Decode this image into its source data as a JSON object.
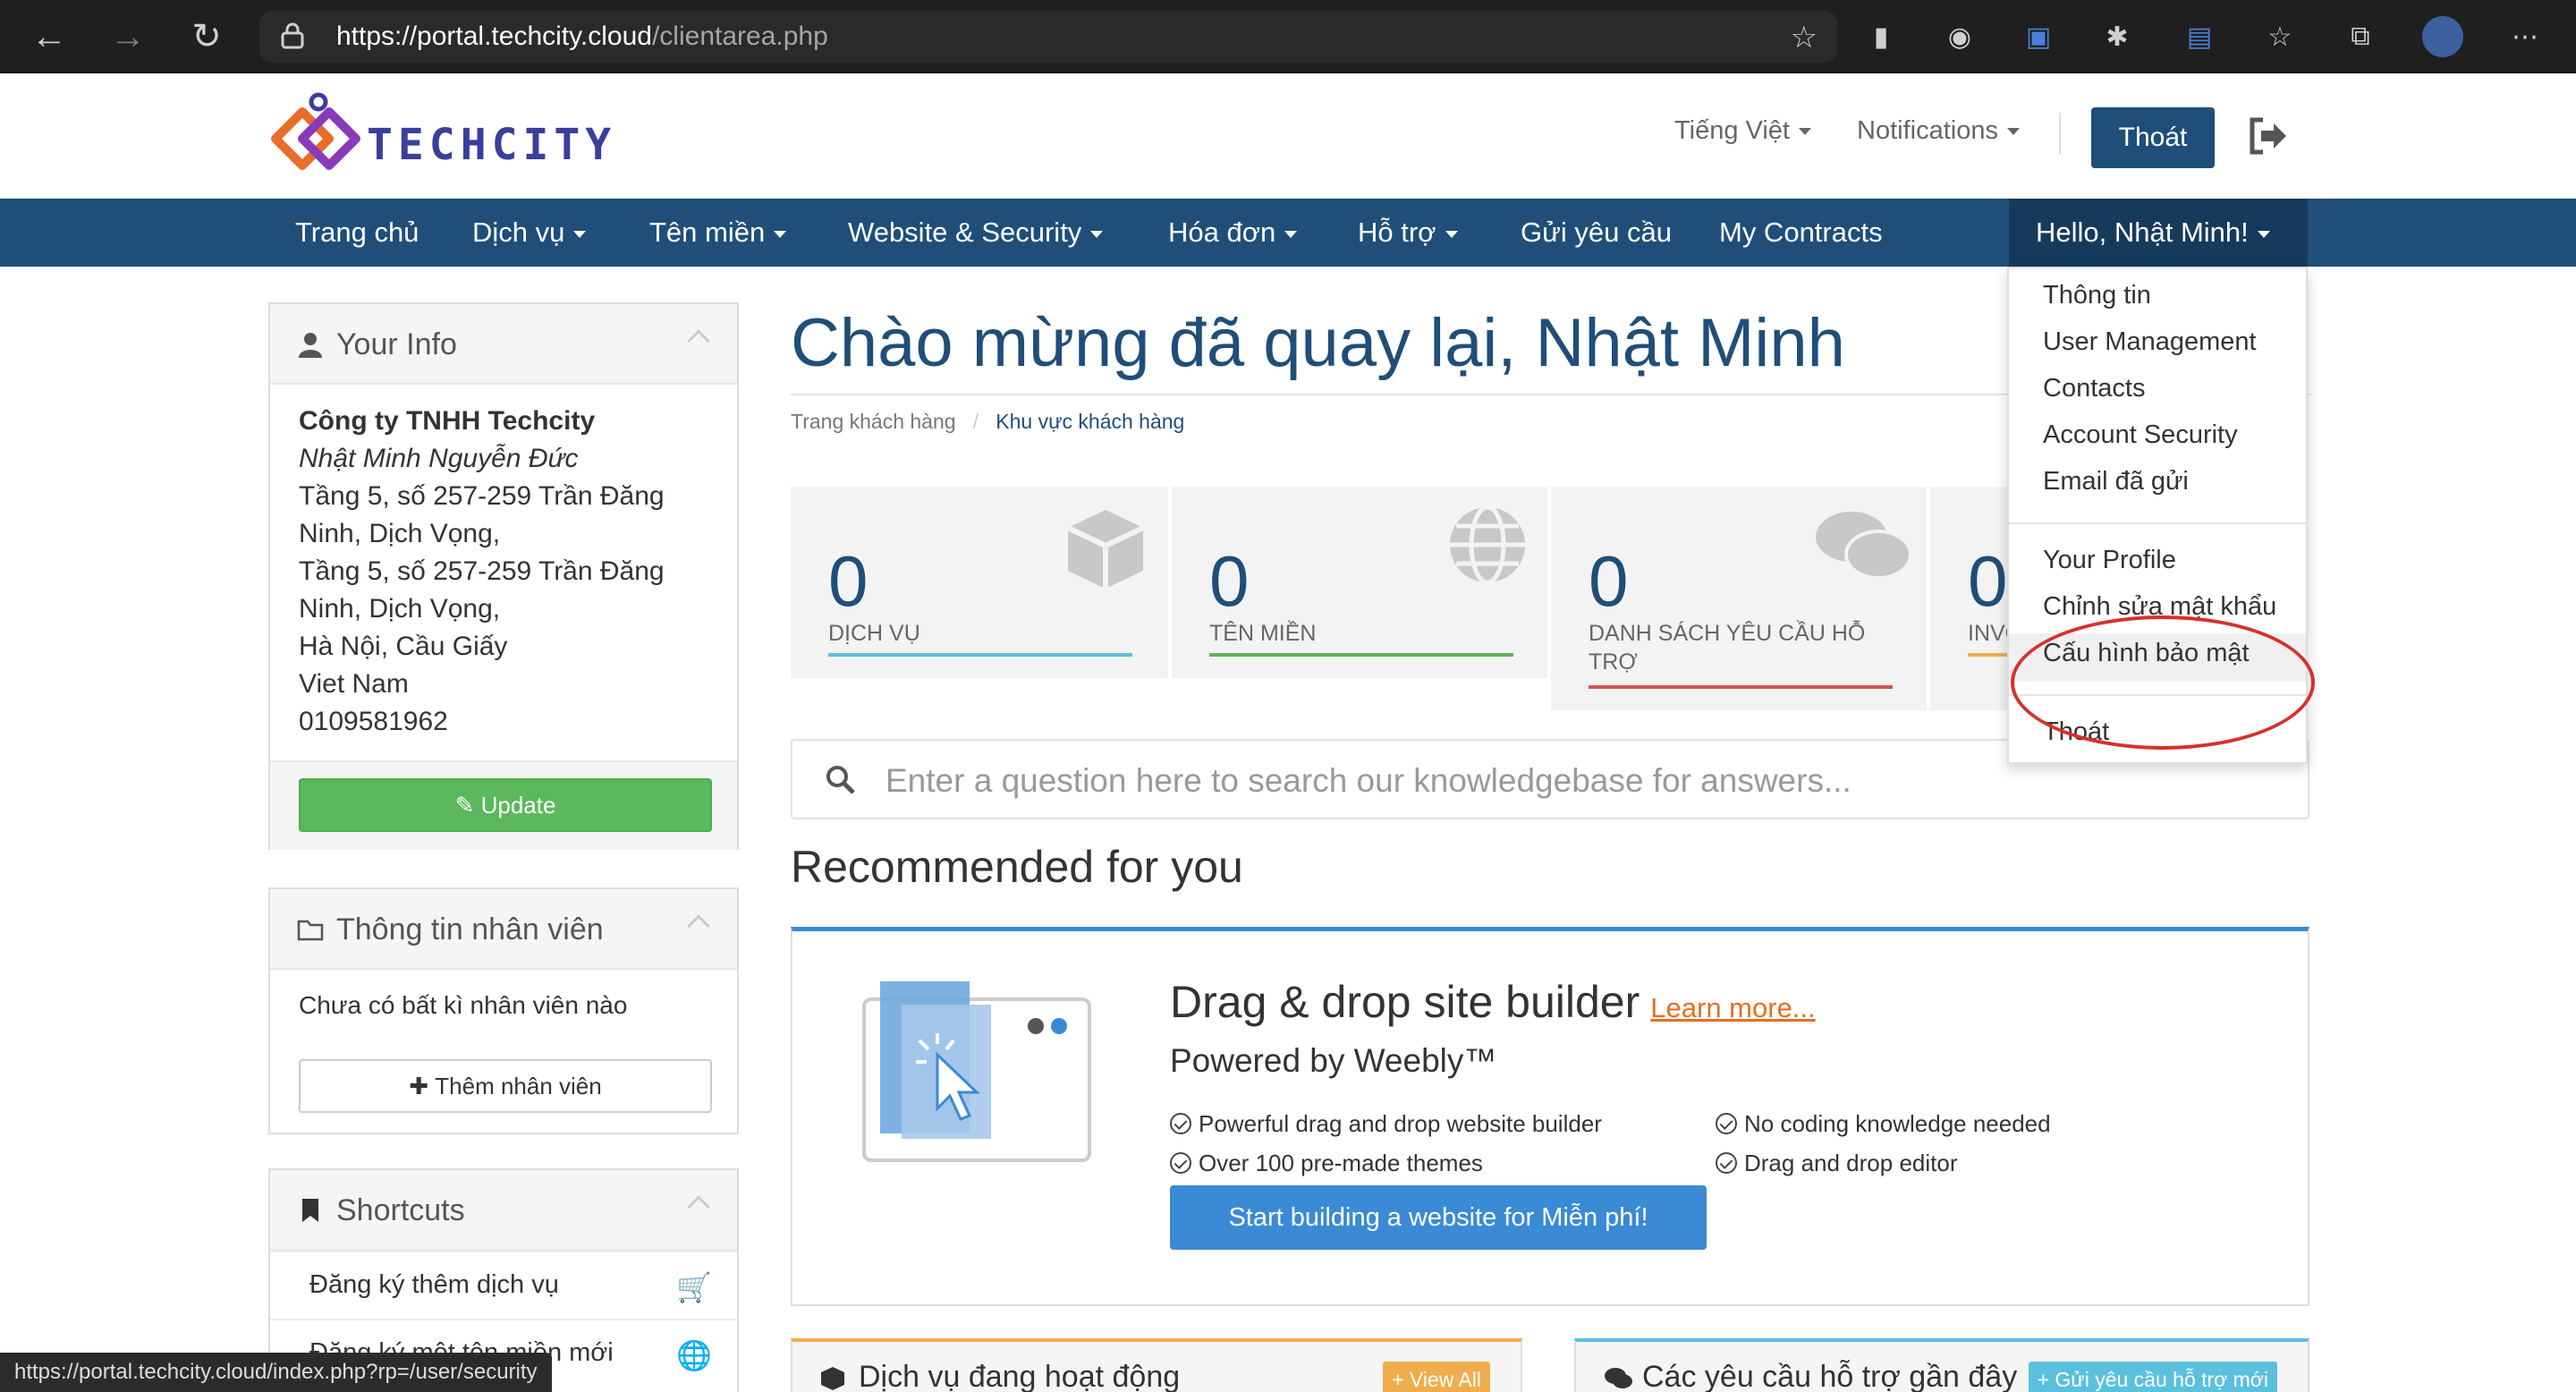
{
  "browser": {
    "url_main": "https://portal.techcity.cloud",
    "url_path": "/clientarea.php",
    "status_url": "https://portal.techcity.cloud/index.php?rp=/user/security"
  },
  "header": {
    "logo_text": "TECHCITY",
    "language": "Tiếng Việt",
    "notifications": "Notifications",
    "logout_button": "Thoát"
  },
  "nav": {
    "items": [
      "Trang chủ",
      "Dịch vụ",
      "Tên miền",
      "Website & Security",
      "Hóa đơn",
      "Hỗ trợ",
      "Gửi yêu cầu",
      "My Contracts"
    ],
    "user": "Hello, Nhật Minh!"
  },
  "dropdown": {
    "items": [
      "Thông tin",
      "User Management",
      "Contacts",
      "Account Security",
      "Email đã gửi",
      "Your Profile",
      "Chỉnh sửa mật khẩu",
      "Cấu hình bảo mật",
      "Thoát"
    ]
  },
  "sidebar": {
    "your_info": {
      "title": "Your Info",
      "company": "Công ty TNHH Techcity",
      "name": "Nhật Minh Nguyễn Đức",
      "address_lines": [
        "Tầng 5, số 257-259 Trần Đăng",
        "Ninh, Dịch Vọng,",
        "Tầng 5, số 257-259 Trần Đăng",
        "Ninh, Dịch Vọng,",
        "Hà Nội, Cầu Giấy",
        "Viet Nam",
        "0109581962"
      ],
      "update_button": "Update"
    },
    "staff": {
      "title": "Thông tin nhân viên",
      "empty": "Chưa có bất kì nhân viên nào",
      "add_button": "Thêm nhân viên"
    },
    "shortcuts": {
      "title": "Shortcuts",
      "items": [
        "Đăng ký thêm dịch vụ",
        "Đăng ký một tên miền mới"
      ]
    }
  },
  "main": {
    "title": "Chào mừng đã quay lại, Nhật Minh",
    "breadcrumb": [
      "Trang khách hàng",
      "/",
      "Khu vực khách hàng"
    ],
    "stats": [
      {
        "value": "0",
        "label": "DỊCH VỤ",
        "color": "#5bc0de"
      },
      {
        "value": "0",
        "label": "TÊN MIỀN",
        "color": "#5cb85c"
      },
      {
        "value": "0",
        "label": "DANH SÁCH YÊU CẦU HỖ TRỢ",
        "color": "#d9534f"
      },
      {
        "value": "0",
        "label": "INVOICES",
        "color": "#f0ad4e"
      }
    ],
    "search_placeholder": "Enter a question here to search our knowledgebase for answers...",
    "recommended": "Recommended for you",
    "promo": {
      "title": "Drag & drop site builder",
      "learn_more": "Learn more...",
      "subtitle": "Powered by Weebly™",
      "features": [
        "Powerful drag and drop website builder",
        "Over 100 pre-made themes",
        "No coding knowledge needed",
        "Drag and drop editor"
      ],
      "cta": "Start building a website for Miễn phí!"
    },
    "bottom": {
      "left_title": "Dịch vụ đang hoạt động",
      "left_tag": "+ View All",
      "right_title": "Các yêu cầu hỗ trợ gần đây",
      "right_tag": "+ Gửi yêu cầu hỗ trợ mới"
    }
  },
  "colors": {
    "brand": "#1f4e79",
    "annotation": "#d9302a"
  }
}
